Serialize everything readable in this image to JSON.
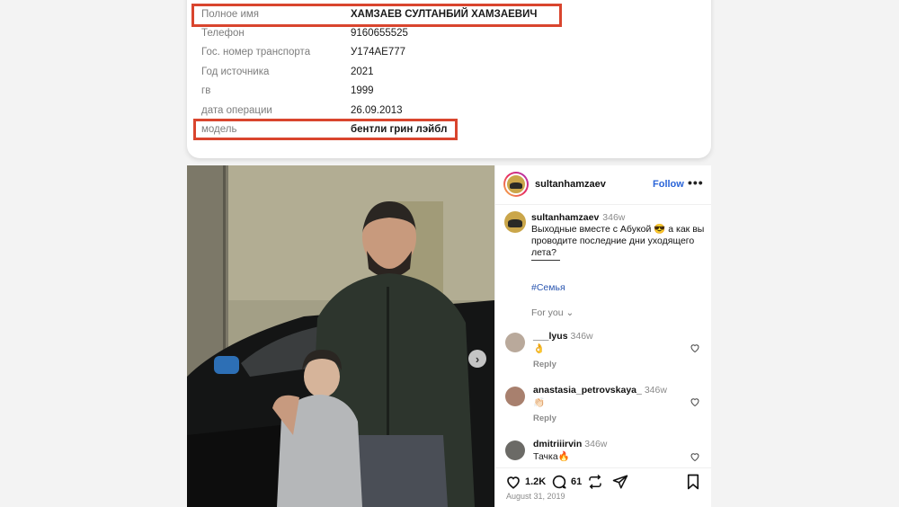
{
  "record": {
    "rows": [
      {
        "label": "Полное имя",
        "value": "ХАМЗАЕВ СУЛТАНБИЙ ХАМЗАЕВИЧ"
      },
      {
        "label": "Телефон",
        "value": "9160655525"
      },
      {
        "label": "Гос. номер транспорта",
        "value": "У174АЕ777"
      },
      {
        "label": "Год источника",
        "value": "2021"
      },
      {
        "label": "гв",
        "value": "1999"
      },
      {
        "label": "дата операции",
        "value": "26.09.2013"
      },
      {
        "label": "модель",
        "value": "бентли грин лэйбл"
      }
    ],
    "highlight_color": "#d9452e"
  },
  "post": {
    "username": "sultanhamzaev",
    "follow_label": "Follow",
    "more_icon": "more-dots-icon",
    "next_icon": "chevron-right-icon",
    "caption": {
      "username": "sultanhamzaev",
      "age": "346w",
      "text": "Выходные вместе с Абукой 😎 а как вы проводите последние дни уходящего лета?",
      "separator": "_____",
      "hashtag": "#Семья"
    },
    "for_you_label": "For you",
    "comments": [
      {
        "username": "___lyus",
        "age": "346w",
        "text": "👌",
        "reply": "Reply"
      },
      {
        "username": "anastasia_petrovskaya_",
        "age": "346w",
        "text": "👏🏻",
        "reply": "Reply"
      },
      {
        "username": "dmitriiirvin",
        "age": "346w",
        "text": "Тачка🔥",
        "reply": ""
      }
    ],
    "likes": "1.2K",
    "comments_count": "61",
    "date": "August 31, 2019",
    "accent_color": "#2a64d8"
  }
}
